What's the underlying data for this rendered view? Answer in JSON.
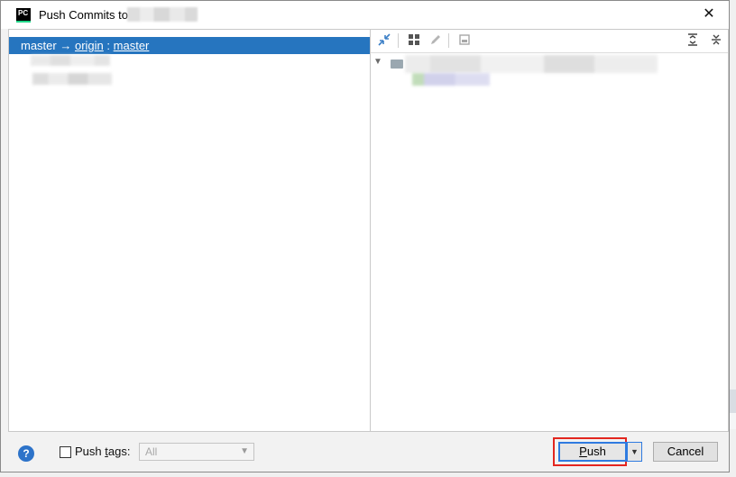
{
  "window": {
    "title": "Push Commits to"
  },
  "left_pane": {
    "branch": {
      "local": "master",
      "arrow": "→",
      "remote": "origin",
      "separator": ":",
      "remote_branch": "master"
    }
  },
  "right_pane": {
    "toolbar": {
      "icons": [
        "expand-arrows-icon",
        "group-icon",
        "edit-icon",
        "diff-icon",
        "expand-all-icon",
        "collapse-all-icon"
      ]
    }
  },
  "footer": {
    "help_label": "?",
    "push_tags_label_prefix": "Push ",
    "push_tags_label_mnemonic": "t",
    "push_tags_label_suffix": "ags:",
    "tags_select_value": "All",
    "push_label_mnemonic": "P",
    "push_label_rest": "ush",
    "cancel_label": "Cancel"
  },
  "colors": {
    "selection": "#2675bf",
    "highlight_box": "#e3261f",
    "focus_border": "#2f7be0"
  }
}
